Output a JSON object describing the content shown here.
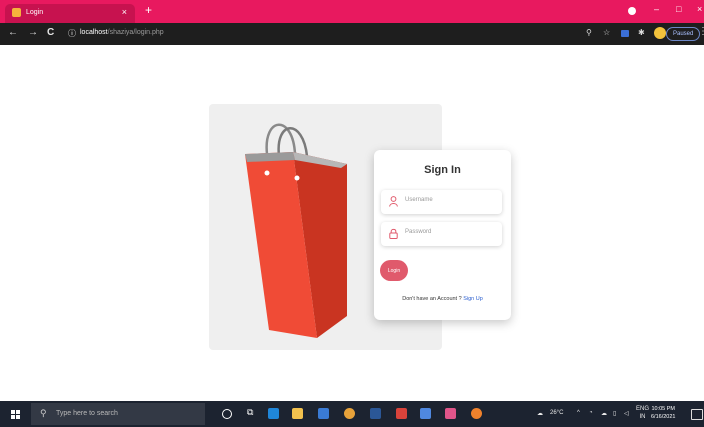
{
  "browser": {
    "tab_title": "Login",
    "tab_close": "×",
    "new_tab": "+",
    "url_host": "localhost",
    "url_path": "/shaziya/login.php",
    "profile_status": "Paused",
    "back": "←",
    "forward": "→",
    "reload": "C",
    "win_minimize": "–",
    "win_restore": "□",
    "win_close": "×"
  },
  "login": {
    "title": "Sign In",
    "username_placeholder": "Username",
    "password_placeholder": "Password",
    "button_label": "Login",
    "signup_prompt": "Don't have an Account ?",
    "signup_link": "Sign Up"
  },
  "taskbar": {
    "search_placeholder": "Type here to search",
    "weather": "26°C",
    "lang": "ENG",
    "lang_region": "IN",
    "time": "10:05 PM",
    "date": "6/16/2021"
  },
  "colors": {
    "chrome_accent": "#e8195f",
    "button": "#e05a6c",
    "bag": "#f04b36",
    "link": "#2c5fcf"
  }
}
